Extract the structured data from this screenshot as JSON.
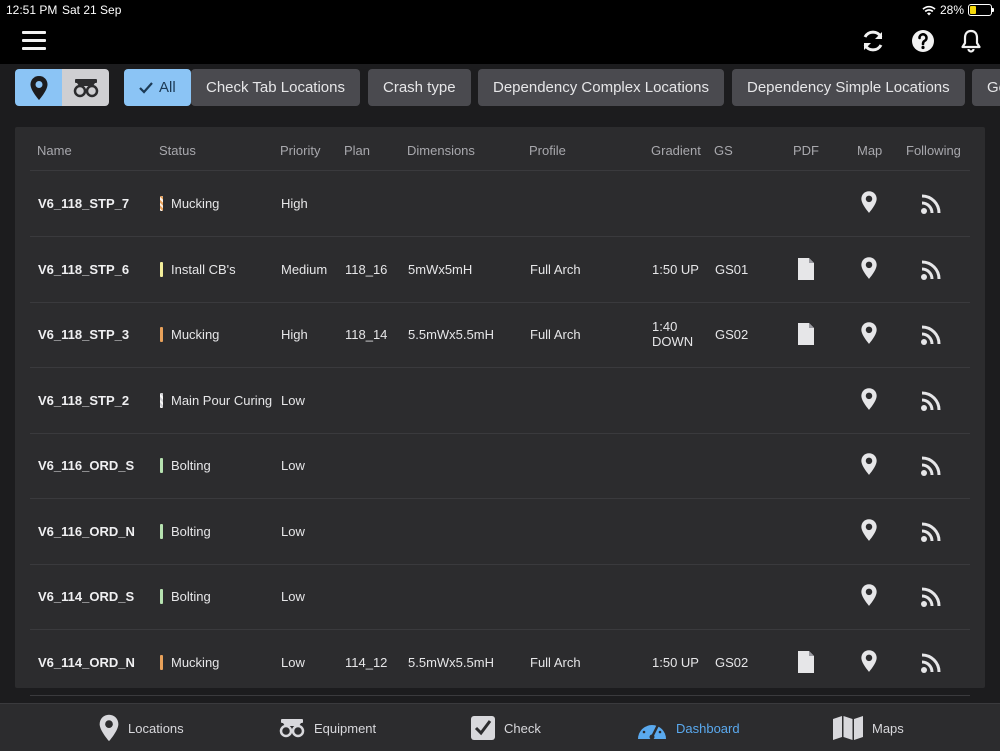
{
  "statusbar": {
    "time": "12:51 PM",
    "date": "Sat 21 Sep",
    "battery": "28%",
    "battery_level": 0.28
  },
  "filters": {
    "all_label": "All",
    "chips": [
      "Check Tab Locations",
      "Crash type",
      "Dependency Complex Locations",
      "Dependency Simple Locations",
      "Ge"
    ]
  },
  "table": {
    "headers": [
      "Name",
      "Status",
      "Priority",
      "Plan",
      "Dimensions",
      "Profile",
      "Gradient",
      "GS",
      "PDF",
      "Map",
      "Following"
    ],
    "rows": [
      {
        "name": "V6_118_STP_7",
        "status": "Mucking",
        "status_color": "#e8a15a",
        "status_style": "hatch",
        "priority": "High",
        "plan": "",
        "dimensions": "",
        "profile": "",
        "gradient": "",
        "gs": "",
        "pdf": false
      },
      {
        "name": "V6_118_STP_6",
        "status": "Install CB's",
        "status_color": "#f3ee9a",
        "status_style": "solid",
        "priority": "Medium",
        "plan": "118_16",
        "dimensions": "5mWx5mH",
        "profile": "Full Arch",
        "gradient": "1:50 UP",
        "gs": "GS01",
        "pdf": true
      },
      {
        "name": "V6_118_STP_3",
        "status": "Mucking",
        "status_color": "#e8a15a",
        "status_style": "solid",
        "priority": "High",
        "plan": "118_14",
        "dimensions": "5.5mWx5.5mH",
        "profile": "Full Arch",
        "gradient": "1:40\nDOWN",
        "gs": "GS02",
        "pdf": true
      },
      {
        "name": "V6_118_STP_2",
        "status": "Main Pour Curing",
        "status_color": "#cfcfd2",
        "status_style": "hatch",
        "priority": "Low",
        "plan": "",
        "dimensions": "",
        "profile": "",
        "gradient": "",
        "gs": "",
        "pdf": false
      },
      {
        "name": "V6_116_ORD_S",
        "status": "Bolting",
        "status_color": "#b6e2b0",
        "status_style": "solid",
        "priority": "Low",
        "plan": "",
        "dimensions": "",
        "profile": "",
        "gradient": "",
        "gs": "",
        "pdf": false
      },
      {
        "name": "V6_116_ORD_N",
        "status": "Bolting",
        "status_color": "#b6e2b0",
        "status_style": "solid",
        "priority": "Low",
        "plan": "",
        "dimensions": "",
        "profile": "",
        "gradient": "",
        "gs": "",
        "pdf": false
      },
      {
        "name": "V6_114_ORD_S",
        "status": "Bolting",
        "status_color": "#b6e2b0",
        "status_style": "solid",
        "priority": "Low",
        "plan": "",
        "dimensions": "",
        "profile": "",
        "gradient": "",
        "gs": "",
        "pdf": false
      },
      {
        "name": "V6_114_ORD_N",
        "status": "Mucking",
        "status_color": "#e8a15a",
        "status_style": "solid",
        "priority": "Low",
        "plan": "114_12",
        "dimensions": "5.5mWx5.5mH",
        "profile": "Full Arch",
        "gradient": "1:50 UP",
        "gs": "GS02",
        "pdf": true
      }
    ]
  },
  "tabbar": {
    "tabs": [
      {
        "label": "Locations",
        "icon": "location-pin-icon",
        "active": false
      },
      {
        "label": "Equipment",
        "icon": "equipment-icon",
        "active": false
      },
      {
        "label": "Check",
        "icon": "check-icon",
        "active": false
      },
      {
        "label": "Dashboard",
        "icon": "dashboard-gauge-icon",
        "active": true
      },
      {
        "label": "Maps",
        "icon": "map-icon",
        "active": false
      }
    ]
  },
  "colors": {
    "accent": "#8bc4f5",
    "active_tab": "#5aa9ee",
    "background": "#1c1c1e",
    "panel": "#2c2c2e"
  }
}
